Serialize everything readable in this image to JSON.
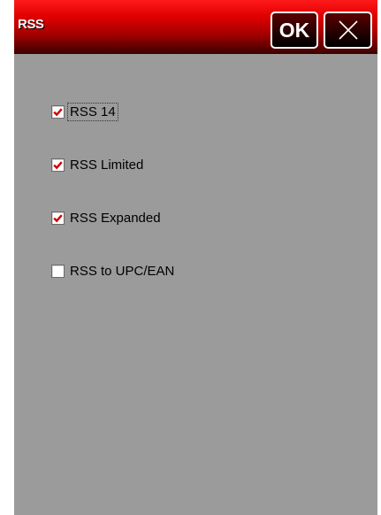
{
  "window": {
    "title": "RSS",
    "ok_label": "OK",
    "close_icon": "close-icon",
    "accent_color": "#d00000"
  },
  "options": [
    {
      "label": "RSS 14",
      "checked": true,
      "focused": true
    },
    {
      "label": "RSS Limited",
      "checked": true,
      "focused": false
    },
    {
      "label": "RSS Expanded",
      "checked": true,
      "focused": false
    },
    {
      "label": "RSS to UPC/EAN",
      "checked": false,
      "focused": false
    }
  ]
}
